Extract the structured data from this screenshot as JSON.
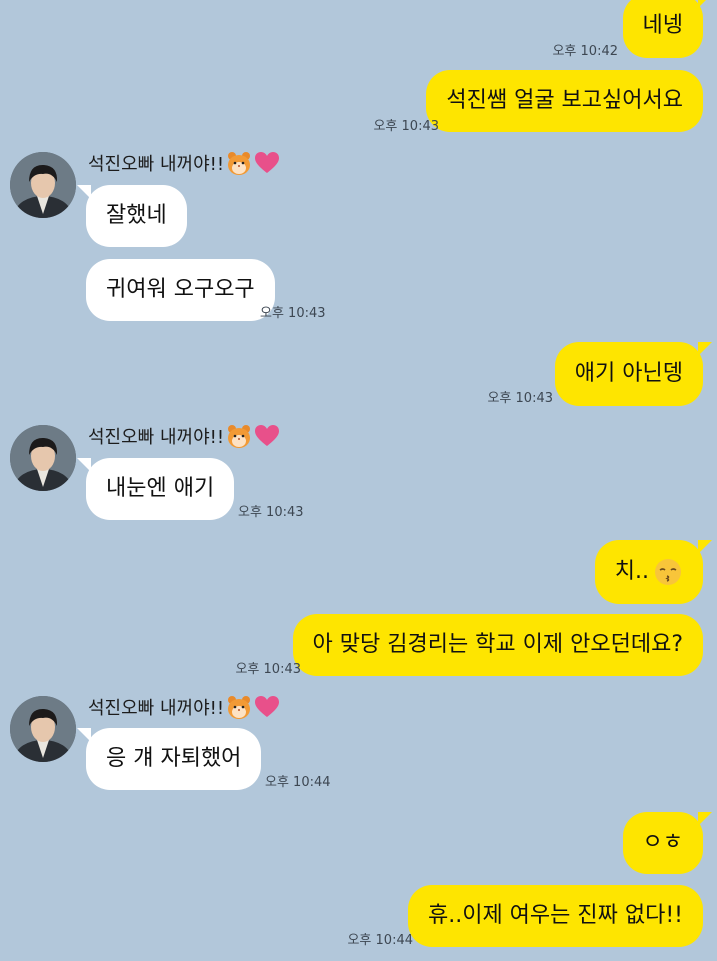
{
  "contact": {
    "name": "석진오빠 내꺼야!!",
    "name_emoji_1": "hamster-face-icon",
    "name_emoji_2": "heart-icon"
  },
  "messages": [
    {
      "side": "me",
      "text": "네넹",
      "time": "오후 10:42"
    },
    {
      "side": "me",
      "text": "석진쌤 얼굴 보고싶어서요",
      "time": "오후 10:43"
    },
    {
      "side": "them",
      "text": "잘했네",
      "time": ""
    },
    {
      "side": "them",
      "text": "귀여워 오구오구",
      "time": "오후 10:43"
    },
    {
      "side": "me",
      "text": "애기 아닌뎅",
      "time": "오후 10:43"
    },
    {
      "side": "them",
      "text": "내눈엔 애기",
      "time": "오후 10:43"
    },
    {
      "side": "me",
      "text": "치..",
      "emoji": "kissing-face-icon",
      "time": ""
    },
    {
      "side": "me",
      "text": "아 맞당 김경리는 학교 이제 안오던데요?",
      "time": "오후 10:43"
    },
    {
      "side": "them",
      "text": "응 걔 자퇴했어",
      "time": "오후 10:44"
    },
    {
      "side": "me",
      "text": "ㅇㅎ",
      "time": ""
    },
    {
      "side": "me",
      "text": "휴..이제 여우는 진짜 없다!!",
      "time": "오후 10:44"
    }
  ],
  "colors": {
    "background": "#b2c7da",
    "my_bubble": "#fee500",
    "their_bubble": "#ffffff"
  }
}
